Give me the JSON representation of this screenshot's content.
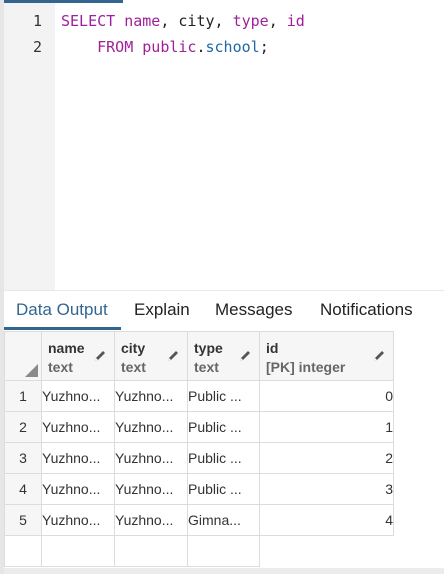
{
  "editor": {
    "line_numbers": [
      "1",
      "2"
    ],
    "line1": {
      "kw_select": "SELECT",
      "col_name": "name",
      "sep1": ", ",
      "col_city": "city",
      "sep2": ", ",
      "col_type": "type",
      "sep3": ", ",
      "col_id": "id"
    },
    "line2": {
      "indent": "    ",
      "kw_from": "FROM",
      "space": " ",
      "schema": "public",
      "dot": ".",
      "table": "school",
      "semi": ";"
    }
  },
  "tabs": [
    {
      "label": "Data Output",
      "active": true
    },
    {
      "label": "Explain",
      "active": false
    },
    {
      "label": "Messages",
      "active": false
    },
    {
      "label": "Notifications",
      "active": false
    }
  ],
  "grid": {
    "columns": [
      {
        "name": "name",
        "type": "text"
      },
      {
        "name": "city",
        "type": "text"
      },
      {
        "name": "type",
        "type": "text"
      },
      {
        "name": "id",
        "type": "[PK] integer"
      }
    ],
    "rows": [
      {
        "num": "1",
        "name": "Yuzhno...",
        "city": "Yuzhno...",
        "type": "Public ...",
        "id": "0"
      },
      {
        "num": "2",
        "name": "Yuzhno...",
        "city": "Yuzhno...",
        "type": "Public ...",
        "id": "1"
      },
      {
        "num": "3",
        "name": "Yuzhno...",
        "city": "Yuzhno...",
        "type": "Public ...",
        "id": "2"
      },
      {
        "num": "4",
        "name": "Yuzhno...",
        "city": "Yuzhno...",
        "type": "Public ...",
        "id": "3"
      },
      {
        "num": "5",
        "name": "Yuzhno...",
        "city": "Yuzhno...",
        "type": "Gimna...",
        "id": "4"
      }
    ]
  },
  "colors": {
    "accent": "#326690",
    "keyword": "#a0209a",
    "table_name": "#2167a8"
  },
  "icons": {
    "edit_column": "pencil-icon",
    "select_all": "select-all-corner-icon"
  }
}
